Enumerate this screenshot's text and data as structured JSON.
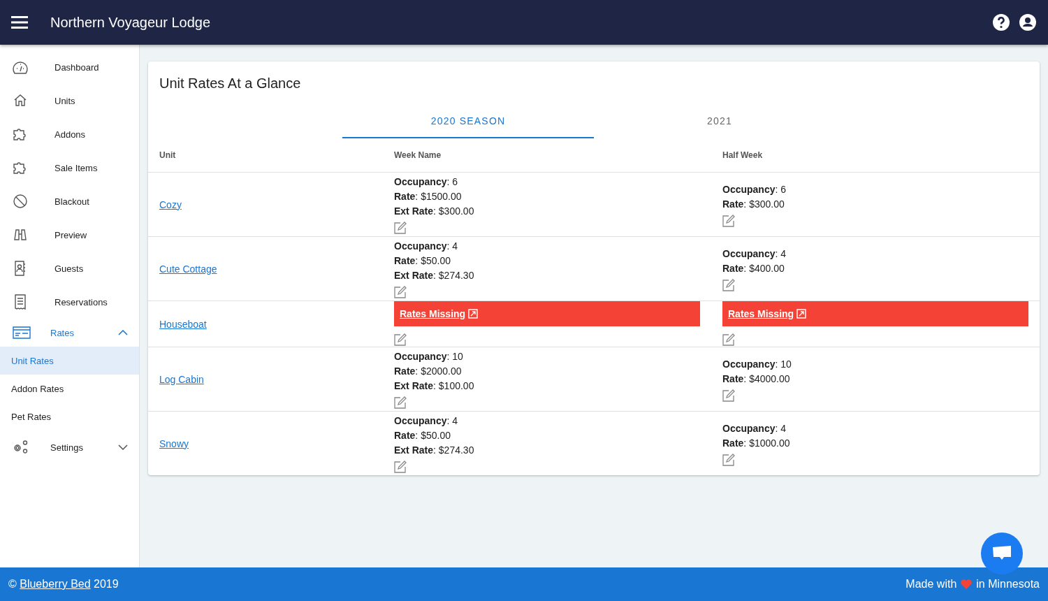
{
  "app_bar": {
    "title": "Northern Voyageur Lodge"
  },
  "sidebar": {
    "items": [
      {
        "label": "Dashboard",
        "selected": false
      },
      {
        "label": "Units",
        "selected": false
      },
      {
        "label": "Addons",
        "selected": false
      },
      {
        "label": "Sale Items",
        "selected": false
      },
      {
        "label": "Blackout",
        "selected": false
      },
      {
        "label": "Preview",
        "selected": false
      },
      {
        "label": "Guests",
        "selected": false
      },
      {
        "label": "Reservations",
        "selected": false
      },
      {
        "label": "Rates",
        "selected": true,
        "expanded": true,
        "children": [
          {
            "label": "Unit Rates",
            "selected": true
          },
          {
            "label": "Addon Rates",
            "selected": false
          },
          {
            "label": "Pet Rates",
            "selected": false
          }
        ]
      },
      {
        "label": "Settings",
        "selected": false,
        "expanded": false
      }
    ]
  },
  "card": {
    "title": "Unit Rates At a Glance",
    "tabs": [
      {
        "label": "2020 SEASON",
        "selected": true
      },
      {
        "label": "2021",
        "selected": false
      }
    ],
    "table": {
      "columns": [
        "Unit",
        "Week Name",
        "Half Week"
      ],
      "rows": [
        {
          "cells": [
            {
              "kind": "unit",
              "text": "Cozy"
            },
            {
              "kind": "rates",
              "lines": [
                {
                  "label": "Occupancy",
                  "value": ": 6"
                },
                {
                  "label": "Rate",
                  "value": ": $1500.00"
                },
                {
                  "label": "Ext Rate",
                  "value": ": $300.00"
                }
              ]
            },
            {
              "kind": "rates",
              "lines": [
                {
                  "label": "Occupancy",
                  "value": ": 6"
                },
                {
                  "label": "Rate",
                  "value": ": $300.00"
                }
              ]
            }
          ]
        },
        {
          "cells": [
            {
              "kind": "unit",
              "text": "Cute Cottage"
            },
            {
              "kind": "rates",
              "lines": [
                {
                  "label": "Occupancy",
                  "value": ": 4"
                },
                {
                  "label": "Rate",
                  "value": ": $50.00"
                },
                {
                  "label": "Ext Rate",
                  "value": ": $274.30"
                }
              ]
            },
            {
              "kind": "rates",
              "lines": [
                {
                  "label": "Occupancy",
                  "value": ": 4"
                },
                {
                  "label": "Rate",
                  "value": ": $400.00"
                }
              ]
            }
          ]
        },
        {
          "cells": [
            {
              "kind": "unit",
              "text": "Houseboat"
            },
            {
              "kind": "missing",
              "text": "Rates Missing"
            },
            {
              "kind": "missing",
              "text": "Rates Missing"
            }
          ]
        },
        {
          "cells": [
            {
              "kind": "unit",
              "text": "Log Cabin"
            },
            {
              "kind": "rates",
              "lines": [
                {
                  "label": "Occupancy",
                  "value": ": 10"
                },
                {
                  "label": "Rate",
                  "value": ": $2000.00"
                },
                {
                  "label": "Ext Rate",
                  "value": ": $100.00"
                }
              ]
            },
            {
              "kind": "rates",
              "lines": [
                {
                  "label": "Occupancy",
                  "value": ": 10"
                },
                {
                  "label": "Rate",
                  "value": ": $4000.00"
                }
              ]
            }
          ]
        },
        {
          "cells": [
            {
              "kind": "unit",
              "text": "Snowy"
            },
            {
              "kind": "rates",
              "lines": [
                {
                  "label": "Occupancy",
                  "value": ": 4"
                },
                {
                  "label": "Rate",
                  "value": ": $50.00"
                },
                {
                  "label": "Ext Rate",
                  "value": ": $274.30"
                }
              ]
            },
            {
              "kind": "rates",
              "lines": [
                {
                  "label": "Occupancy",
                  "value": ": 4"
                },
                {
                  "label": "Rate",
                  "value": ": $1000.00"
                }
              ]
            }
          ]
        }
      ]
    }
  },
  "footer": {
    "copyright": "©",
    "link": "Blueberry Bed",
    "year": "2019",
    "made_with": "Made with",
    "made_in": "in Minnesota"
  }
}
